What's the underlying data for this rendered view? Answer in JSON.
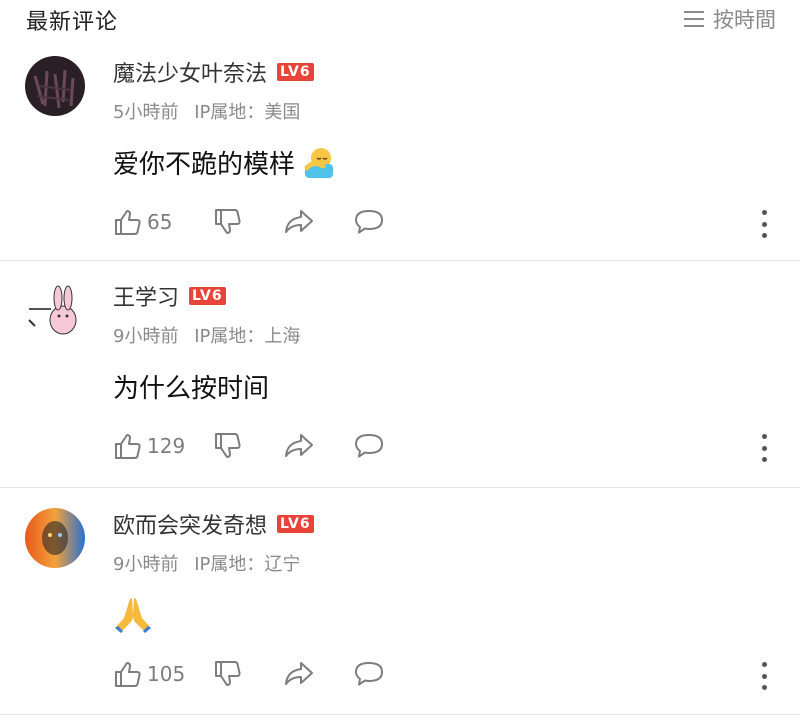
{
  "header": {
    "title": "最新评论",
    "sort_label": "按時間"
  },
  "comments": [
    {
      "username": "魔法少女叶奈法",
      "level": "LV6",
      "time": "5小時前",
      "ip": "IP属地：美国",
      "text": "爱你不跪的模样",
      "likes": "65"
    },
    {
      "username": "王学习",
      "level": "LV6",
      "time": "9小時前",
      "ip": "IP属地：上海",
      "text": "为什么按时间",
      "likes": "129"
    },
    {
      "username": "欧而会突发奇想",
      "level": "LV6",
      "time": "9小時前",
      "ip": "IP属地：辽宁",
      "text": "",
      "likes": "105"
    }
  ],
  "colors": {
    "badge": "#e8443a",
    "meta": "#8a8a8a",
    "icon": "#7d7d7d"
  },
  "icons": [
    "thumbs-up-icon",
    "thumbs-down-icon",
    "share-icon",
    "comment-icon",
    "more-icon",
    "sort-icon"
  ]
}
